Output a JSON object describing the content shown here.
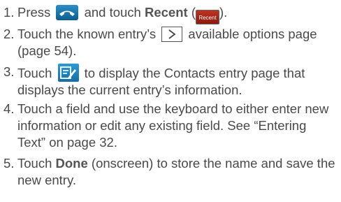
{
  "steps": [
    {
      "num": "1.",
      "t1": "Press",
      "t2": "and touch",
      "recent_label": "Recent",
      "t3": "(",
      "recent_key_text": "Recent",
      "t4": ")."
    },
    {
      "num": "2.",
      "t1": "Touch the known entry’s",
      "t2": "available options page (page 54)."
    },
    {
      "num": "3.",
      "t1": "Touch",
      "t2": "to display the Contacts entry page that displays the current entry’s information."
    },
    {
      "num": "4.",
      "text": "Touch a field and use the keyboard to either enter new information or edit any existing field. See “Entering Text” on page 32."
    },
    {
      "num": "5.",
      "t1": "Touch",
      "done_label": "Done",
      "t2": "(onscreen) to store the name and save the new entry."
    }
  ],
  "icons": {
    "phone": "phone-handset-icon",
    "recent": "recent-key-icon",
    "chevron": "chevron-right-icon",
    "edit": "edit-contact-icon"
  },
  "colors": {
    "text": "#4a4a4a",
    "phone_icon": "#1a78ad",
    "recent_key": "#b02a1a",
    "edit_icon": "#2388c4"
  }
}
